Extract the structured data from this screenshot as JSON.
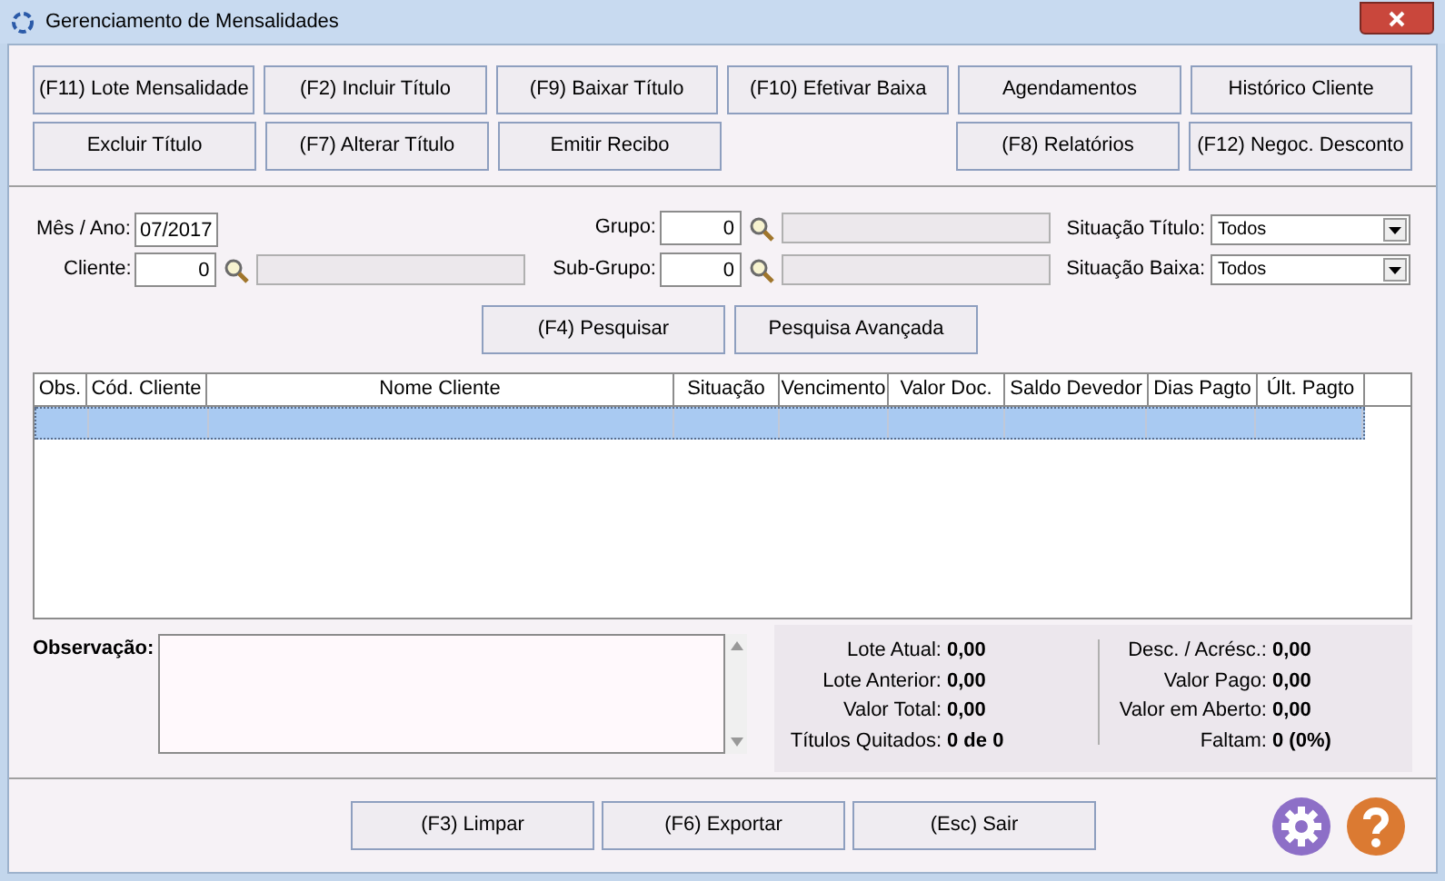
{
  "window": {
    "title": "Gerenciamento de Mensalidades"
  },
  "toolbar": {
    "row_1": [
      "(F11) Lote Mensalidade",
      "(F2) Incluir Título",
      "(F9) Baixar Título",
      "(F10) Efetivar Baixa",
      "Agendamentos",
      "Histórico Cliente"
    ],
    "row_2_left": [
      "Excluir Título",
      "(F7) Alterar Título",
      "Emitir Recibo"
    ],
    "row_2_right": [
      "(F8) Relatórios",
      "(F12) Negoc. Desconto"
    ]
  },
  "filters": {
    "mes_ano": {
      "label": "Mês / Ano:",
      "value": "07/2017"
    },
    "cliente": {
      "label": "Cliente:",
      "value": "0"
    },
    "grupo": {
      "label": "Grupo:",
      "value": "0"
    },
    "sub_grupo": {
      "label": "Sub-Grupo:",
      "value": "0"
    },
    "situacao_titulo": {
      "label": "Situação Título:",
      "value": "Todos"
    },
    "situacao_baixa": {
      "label": "Situação Baixa:",
      "value": "Todos"
    }
  },
  "search_buttons": [
    "(F4) Pesquisar",
    "Pesquisa Avançada"
  ],
  "table": {
    "columns": [
      "Obs.",
      "Cód. Cliente",
      "Nome Cliente",
      "Situação",
      "Vencimento",
      "Valor Doc.",
      "Saldo Devedor",
      "Dias Pagto",
      "Últ. Pagto"
    ],
    "rows": [
      {
        "selected": true
      }
    ]
  },
  "observacao": {
    "label": "Observação:"
  },
  "summary_left": [
    {
      "label": "Lote Atual:",
      "value": "0,00"
    },
    {
      "label": "Lote Anterior:",
      "value": "0,00"
    },
    {
      "label": "Valor Total:",
      "value": "0,00"
    },
    {
      "label": "Títulos Quitados:",
      "value": "0 de 0"
    }
  ],
  "summary_right": [
    {
      "label": "Desc. / Acrésc.:",
      "value": "0,00"
    },
    {
      "label": "Valor Pago:",
      "value": "0,00"
    },
    {
      "label": "Valor em Aberto:",
      "value": "0,00"
    },
    {
      "label": "Faltam:",
      "value": "0 (0%)"
    }
  ],
  "footer_buttons": [
    "(F3) Limpar",
    "(F6) Exportar",
    "(Esc) Sair"
  ]
}
